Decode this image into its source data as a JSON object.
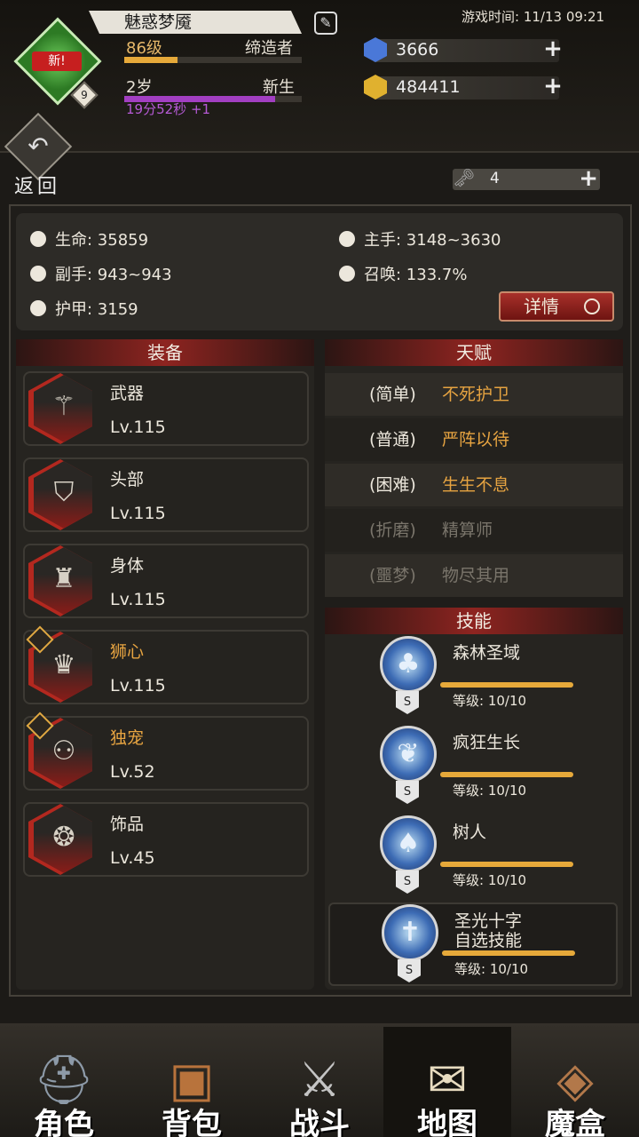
{
  "header": {
    "player_name": "魅惑梦魇",
    "new_badge": "新!",
    "avatar_level": "9",
    "level_text": "86级",
    "title_text": "缔造者",
    "level_progress": 0.3,
    "age_text": "2岁",
    "status_text": "新生",
    "age_progress": 0.85,
    "timer_text": "19分52秒 +1",
    "game_time": "游戏时间: 11/13 09:21",
    "gems": "3666",
    "gold": "484411",
    "keys": "4",
    "back_label": "返回"
  },
  "colors": {
    "level_bar": "#e6a93a",
    "age_bar": "#a23fc2",
    "gem": "#4a78d8",
    "gold": "#e0b12f",
    "accent_red": "#8e2420"
  },
  "stats": {
    "life": "生命: 35859",
    "main_hand": "主手: 3148~3630",
    "off_hand": "副手: 943~943",
    "summon": "召唤: 133.7%",
    "armor": "护甲: 3159",
    "detail_button": "详情"
  },
  "equipment": {
    "title": "装备",
    "items": [
      {
        "name": "武器",
        "level": "Lv.115",
        "icon": "staff-icon",
        "special": false
      },
      {
        "name": "头部",
        "level": "Lv.115",
        "icon": "hat-icon",
        "special": false
      },
      {
        "name": "身体",
        "level": "Lv.115",
        "icon": "armor-icon",
        "special": false
      },
      {
        "name": "狮心",
        "level": "Lv.115",
        "icon": "lion-helm-icon",
        "special": true
      },
      {
        "name": "独宠",
        "level": "Lv.52",
        "icon": "boots-icon",
        "special": true
      },
      {
        "name": "饰品",
        "level": "Lv.45",
        "icon": "trinket-icon",
        "special": false
      }
    ]
  },
  "talents": {
    "title": "天赋",
    "items": [
      {
        "difficulty": "(简单)",
        "name": "不死护卫",
        "active": true
      },
      {
        "difficulty": "(普通)",
        "name": "严阵以待",
        "active": true
      },
      {
        "difficulty": "(困难)",
        "name": "生生不息",
        "active": true
      },
      {
        "difficulty": "(折磨)",
        "name": "精算师",
        "active": false
      },
      {
        "difficulty": "(噩梦)",
        "name": "物尽其用",
        "active": false
      }
    ]
  },
  "skills": {
    "title": "技能",
    "items": [
      {
        "name": "森林圣域",
        "level": "等级: 10/10",
        "badge": "S",
        "icon": "forest-sanctuary-icon",
        "progress": 1.0
      },
      {
        "name": "疯狂生长",
        "level": "等级: 10/10",
        "badge": "S",
        "icon": "wild-growth-icon",
        "progress": 1.0
      },
      {
        "name": "树人",
        "level": "等级: 10/10",
        "badge": "S",
        "icon": "treant-icon",
        "progress": 1.0
      },
      {
        "name": "圣光十字\n自选技能",
        "level": "等级: 10/10",
        "badge": "S",
        "icon": "holy-cross-icon",
        "progress": 1.0
      }
    ]
  },
  "nav": {
    "items": [
      {
        "label": "角色",
        "icon": "helmet-icon",
        "active": false
      },
      {
        "label": "背包",
        "icon": "backpack-icon",
        "active": false
      },
      {
        "label": "战斗",
        "icon": "sword-shield-icon",
        "active": false
      },
      {
        "label": "地图",
        "icon": "scroll-map-icon",
        "active": true
      },
      {
        "label": "魔盒",
        "icon": "magic-box-icon",
        "active": false
      }
    ]
  }
}
